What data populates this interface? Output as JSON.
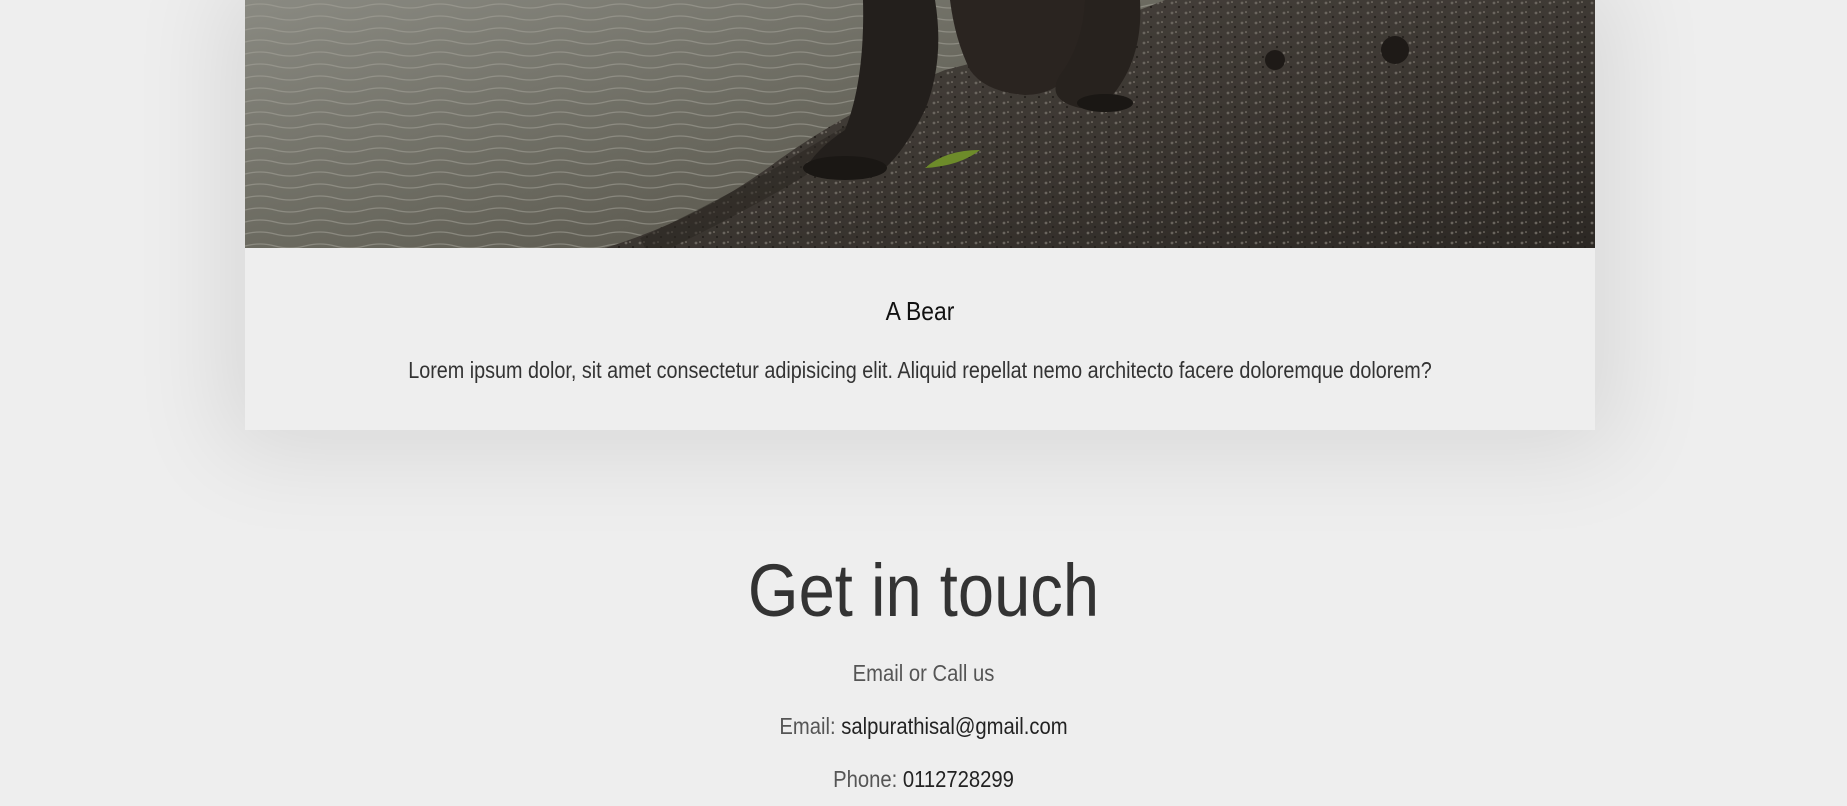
{
  "card": {
    "image_alt": "bear on shore",
    "title": "A Bear",
    "description": "Lorem ipsum dolor, sit amet consectetur adipisicing elit. Aliquid repellat nemo architecto facere doloremque dolorem?"
  },
  "contact": {
    "heading": "Get in touch",
    "subheading": "Email or Call us",
    "email_label": "Email: ",
    "email_value": "salpurathisal@gmail.com",
    "phone_label": "Phone: ",
    "phone_value": "0112728299"
  },
  "colors": {
    "background": "#eeeeee",
    "heading_text": "#333333",
    "body_text": "#555555"
  }
}
